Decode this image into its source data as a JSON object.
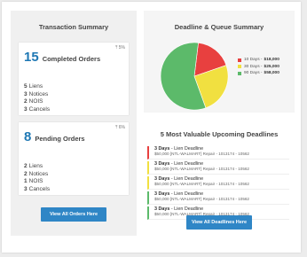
{
  "transaction_summary": {
    "title": "Transaction Summary",
    "completed": {
      "count": "15",
      "label": "Completed Orders",
      "pct": "⤒ 5%",
      "stats": [
        {
          "num": "5",
          "label": "Liens"
        },
        {
          "num": "3",
          "label": "Notices"
        },
        {
          "num": "2",
          "label": "NOIS"
        },
        {
          "num": "3",
          "label": "Cancels"
        }
      ]
    },
    "pending": {
      "count": "8",
      "label": "Pending Orders",
      "pct": "⤒ 6%",
      "stats": [
        {
          "num": "2",
          "label": "Liens"
        },
        {
          "num": "2",
          "label": "Notices"
        },
        {
          "num": "1",
          "label": "NOIS"
        },
        {
          "num": "3",
          "label": "Cancels"
        }
      ]
    },
    "button_label": "View All Orders Here"
  },
  "queue_summary": {
    "title": "Deadline & Queue Summary",
    "legend": [
      {
        "label": "10 Days -",
        "value": "$18,000",
        "color": "#e8403f"
      },
      {
        "label": "30 Days -",
        "value": "$25,000",
        "color": "#f1e040"
      },
      {
        "label": "90 Days -",
        "value": "$58,000",
        "color": "#5cba6a"
      }
    ],
    "pie_values": [
      18000,
      25000,
      58000
    ]
  },
  "deadlines": {
    "title": "5 Most Valuable Upcoming Deadlines",
    "items": [
      {
        "days": "3 Days",
        "type": " - Lien Deadline",
        "desc": "$50,000 [NTL-WALMART] Repair - 1013174 - 10562",
        "color": "#e8403f"
      },
      {
        "days": "3 Days",
        "type": " - Lien Deadline",
        "desc": "$50,000 [NTL-WALMART] Repair - 1013174 - 10562",
        "color": "#f1e040"
      },
      {
        "days": "3 Days",
        "type": " - Lien Deadline",
        "desc": "$50,000 [NTL-WALMART] Repair - 1013174 - 10562",
        "color": "#f1e040"
      },
      {
        "days": "3 Days",
        "type": " - Lien Deadline",
        "desc": "$50,000 [NTL-WALMART] Repair - 1013174 - 10562",
        "color": "#5cba6a"
      },
      {
        "days": "3 Days",
        "type": " - Lien Deadline",
        "desc": "$50,000 [NTL-WALMART] Repair - 1013174 - 10562",
        "color": "#5cba6a"
      }
    ],
    "button_label": "View All Deadlines Here"
  }
}
